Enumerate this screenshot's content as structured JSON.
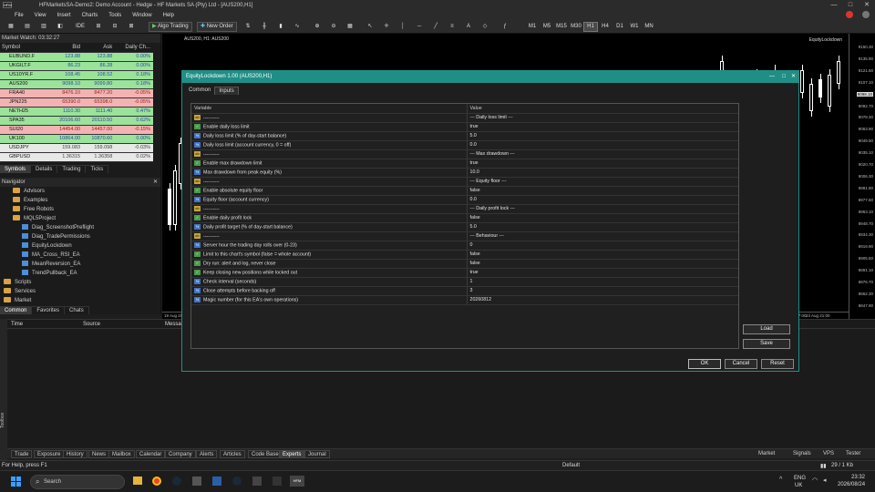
{
  "window": {
    "logo": "HFM",
    "title": "HFMarketsSA-Demo2: Demo Account - Hedge - HF Markets SA (Pty) Ltd - [AUS200,H1]",
    "controls": [
      "—",
      "□",
      "✕"
    ]
  },
  "menu": [
    "File",
    "View",
    "Insert",
    "Charts",
    "Tools",
    "Window",
    "Help"
  ],
  "toolbar": {
    "ide_label": "IDE",
    "algo_trading_label": "Algo Trading",
    "new_order_label": "New Order",
    "timeframes": [
      "M1",
      "M5",
      "M15",
      "M30",
      "H1",
      "H4",
      "D1",
      "W1",
      "MN"
    ],
    "active_timeframe": "H1"
  },
  "market_watch": {
    "title": "Market Watch: 03:32:27",
    "columns": [
      "Symbol",
      "Bid",
      "Ask",
      "Daily Ch..."
    ],
    "rows": [
      {
        "symbol": "EUBUND.F",
        "bid": "123.88",
        "ask": "123.88",
        "change": "0.00%",
        "dir": "up"
      },
      {
        "symbol": "UKGILT.F",
        "bid": "86.23",
        "ask": "86.28",
        "change": "0.00%",
        "dir": "up"
      },
      {
        "symbol": "US10YR.F",
        "bid": "108.45",
        "ask": "108.52",
        "change": "0.18%",
        "dir": "up"
      },
      {
        "symbol": "AUS200",
        "bid": "9098.10",
        "ask": "9099.80",
        "change": "0.18%",
        "dir": "up"
      },
      {
        "symbol": "FRA40",
        "bid": "8476.10",
        "ask": "8477.20",
        "change": "-0.05%",
        "dir": "dn"
      },
      {
        "symbol": "JPN225",
        "bid": "65390.0",
        "ask": "65398.0",
        "change": "-0.05%",
        "dir": "dn"
      },
      {
        "symbol": "NETH25",
        "bid": "1110.30",
        "ask": "1111.40",
        "change": "0.47%",
        "dir": "up"
      },
      {
        "symbol": "SPA35",
        "bid": "20106.60",
        "ask": "20110.50",
        "change": "0.62%",
        "dir": "up"
      },
      {
        "symbol": "SUI20",
        "bid": "14454.00",
        "ask": "14457.00",
        "change": "-0.15%",
        "dir": "dn"
      },
      {
        "symbol": "UK100",
        "bid": "10864.00",
        "ask": "10870.60",
        "change": "0.00%",
        "dir": "up"
      },
      {
        "symbol": "USDJPY",
        "bid": "159.083",
        "ask": "159.098",
        "change": "-0.03%",
        "dir": "nt"
      },
      {
        "symbol": "GBPUSD",
        "bid": "1.36315",
        "ask": "1.36358",
        "change": "0.02%",
        "dir": "nt"
      }
    ],
    "tabs": [
      "Symbols",
      "Details",
      "Trading",
      "Ticks"
    ]
  },
  "navigator": {
    "title": "Navigator",
    "items": [
      {
        "label": "Advisors",
        "depth": 1,
        "kind": "folder"
      },
      {
        "label": "Examples",
        "depth": 1,
        "kind": "folder"
      },
      {
        "label": "Free Robots",
        "depth": 1,
        "kind": "folder"
      },
      {
        "label": "MQL5Project",
        "depth": 1,
        "kind": "folder"
      },
      {
        "label": "Diag_ScreenshotPreflight",
        "depth": 2,
        "kind": "ea"
      },
      {
        "label": "Diag_TradePermissions",
        "depth": 2,
        "kind": "ea"
      },
      {
        "label": "EquityLockdown",
        "depth": 2,
        "kind": "ea"
      },
      {
        "label": "MA_Cross_RSI_EA",
        "depth": 2,
        "kind": "ea"
      },
      {
        "label": "MeanReversion_EA",
        "depth": 2,
        "kind": "ea"
      },
      {
        "label": "TrendPullback_EA",
        "depth": 2,
        "kind": "ea"
      },
      {
        "label": "Scripts",
        "depth": 0,
        "kind": "folder"
      },
      {
        "label": "Services",
        "depth": 0,
        "kind": "folder"
      },
      {
        "label": "Market",
        "depth": 0,
        "kind": "folder"
      }
    ],
    "tabs": [
      "Common",
      "Favorites",
      "Chats"
    ]
  },
  "chart": {
    "tab_label": "AUS200, H1: AUS200",
    "indicator_label": "EquityLockdown",
    "prices": [
      "9150.30",
      "9135.90",
      "9121.50",
      "9107.10",
      "9098.10",
      "9092.70",
      "9078.30",
      "9063.90",
      "9049.50",
      "9035.10",
      "9020.70",
      "9006.30",
      "8991.90",
      "8977.50",
      "8963.10",
      "8948.70",
      "8934.30",
      "8919.90",
      "8905.50",
      "8891.10",
      "8876.70",
      "8862.30",
      "8847.90"
    ],
    "time_labels": [
      "19 Aug 2025",
      "24 Aug 17:00",
      "24 Aug 21:00"
    ]
  },
  "toolbox": {
    "columns": [
      "Time",
      "Source",
      "Message"
    ],
    "side_label": "Toolbox",
    "tabs": [
      "Trade",
      "Exposure",
      "History",
      "News",
      "Mailbox",
      "Calendar",
      "Company",
      "Alerts",
      "Articles",
      "Code Base",
      "Experts",
      "Journal"
    ],
    "active_tab": "Experts",
    "right": [
      "Market",
      "Signals",
      "VPS",
      "Tester"
    ]
  },
  "status": {
    "help": "For Help, press F1",
    "profile": "Default",
    "traffic": "29 / 1 Kb"
  },
  "dialog": {
    "title": "EquityLockdown 1.00 (AUS200,H1)",
    "tabs": [
      "Common",
      "Inputs"
    ],
    "active_tab": "Inputs",
    "columns": [
      "Variable",
      "Value"
    ],
    "params": [
      {
        "icon": "ab",
        "name": "----------",
        "value": "--- Daily loss limit ---"
      },
      {
        "icon": "bo",
        "name": "Enable daily loss limit",
        "value": "true"
      },
      {
        "icon": "nu",
        "name": "Daily loss limit (% of day-start balance)",
        "value": "5.0"
      },
      {
        "icon": "nu",
        "name": "Daily loss limit (account currency, 0 = off)",
        "value": "0.0"
      },
      {
        "icon": "ab",
        "name": "----------",
        "value": "--- Max drawdown ---"
      },
      {
        "icon": "bo",
        "name": "Enable max drawdown limit",
        "value": "true"
      },
      {
        "icon": "nu",
        "name": "Max drawdown from peak equity (%)",
        "value": "10.0"
      },
      {
        "icon": "ab",
        "name": "----------",
        "value": "--- Equity floor ---"
      },
      {
        "icon": "bo",
        "name": "Enable absolute equity floor",
        "value": "false"
      },
      {
        "icon": "nu",
        "name": "Equity floor (account currency)",
        "value": "0.0"
      },
      {
        "icon": "ab",
        "name": "----------",
        "value": "--- Daily profit lock ---"
      },
      {
        "icon": "bo",
        "name": "Enable daily profit lock",
        "value": "false"
      },
      {
        "icon": "nu",
        "name": "Daily profit target (% of day-start balance)",
        "value": "5.0"
      },
      {
        "icon": "ab",
        "name": "----------",
        "value": "--- Behaviour ---"
      },
      {
        "icon": "nu",
        "name": "Server hour the trading day rolls over (0-23)",
        "value": "0"
      },
      {
        "icon": "bo",
        "name": "Limit to this chart's symbol (false = whole account)",
        "value": "false"
      },
      {
        "icon": "bo",
        "name": "Dry run: alert and log, never close",
        "value": "false"
      },
      {
        "icon": "bo",
        "name": "Keep closing new positions while locked out",
        "value": "true"
      },
      {
        "icon": "nu",
        "name": "Check interval (seconds)",
        "value": "1"
      },
      {
        "icon": "nu",
        "name": "Close attempts before backing off",
        "value": "3"
      },
      {
        "icon": "nu",
        "name": "Magic number (for this EA's own operations)",
        "value": "20260812"
      }
    ],
    "load_label": "Load",
    "save_label": "Save",
    "ok_label": "OK",
    "cancel_label": "Cancel",
    "reset_label": "Reset"
  },
  "taskbar": {
    "search_placeholder": "Search",
    "lang": "ENG",
    "region": "UK",
    "time": "23:32",
    "date": "2026/08/24"
  }
}
